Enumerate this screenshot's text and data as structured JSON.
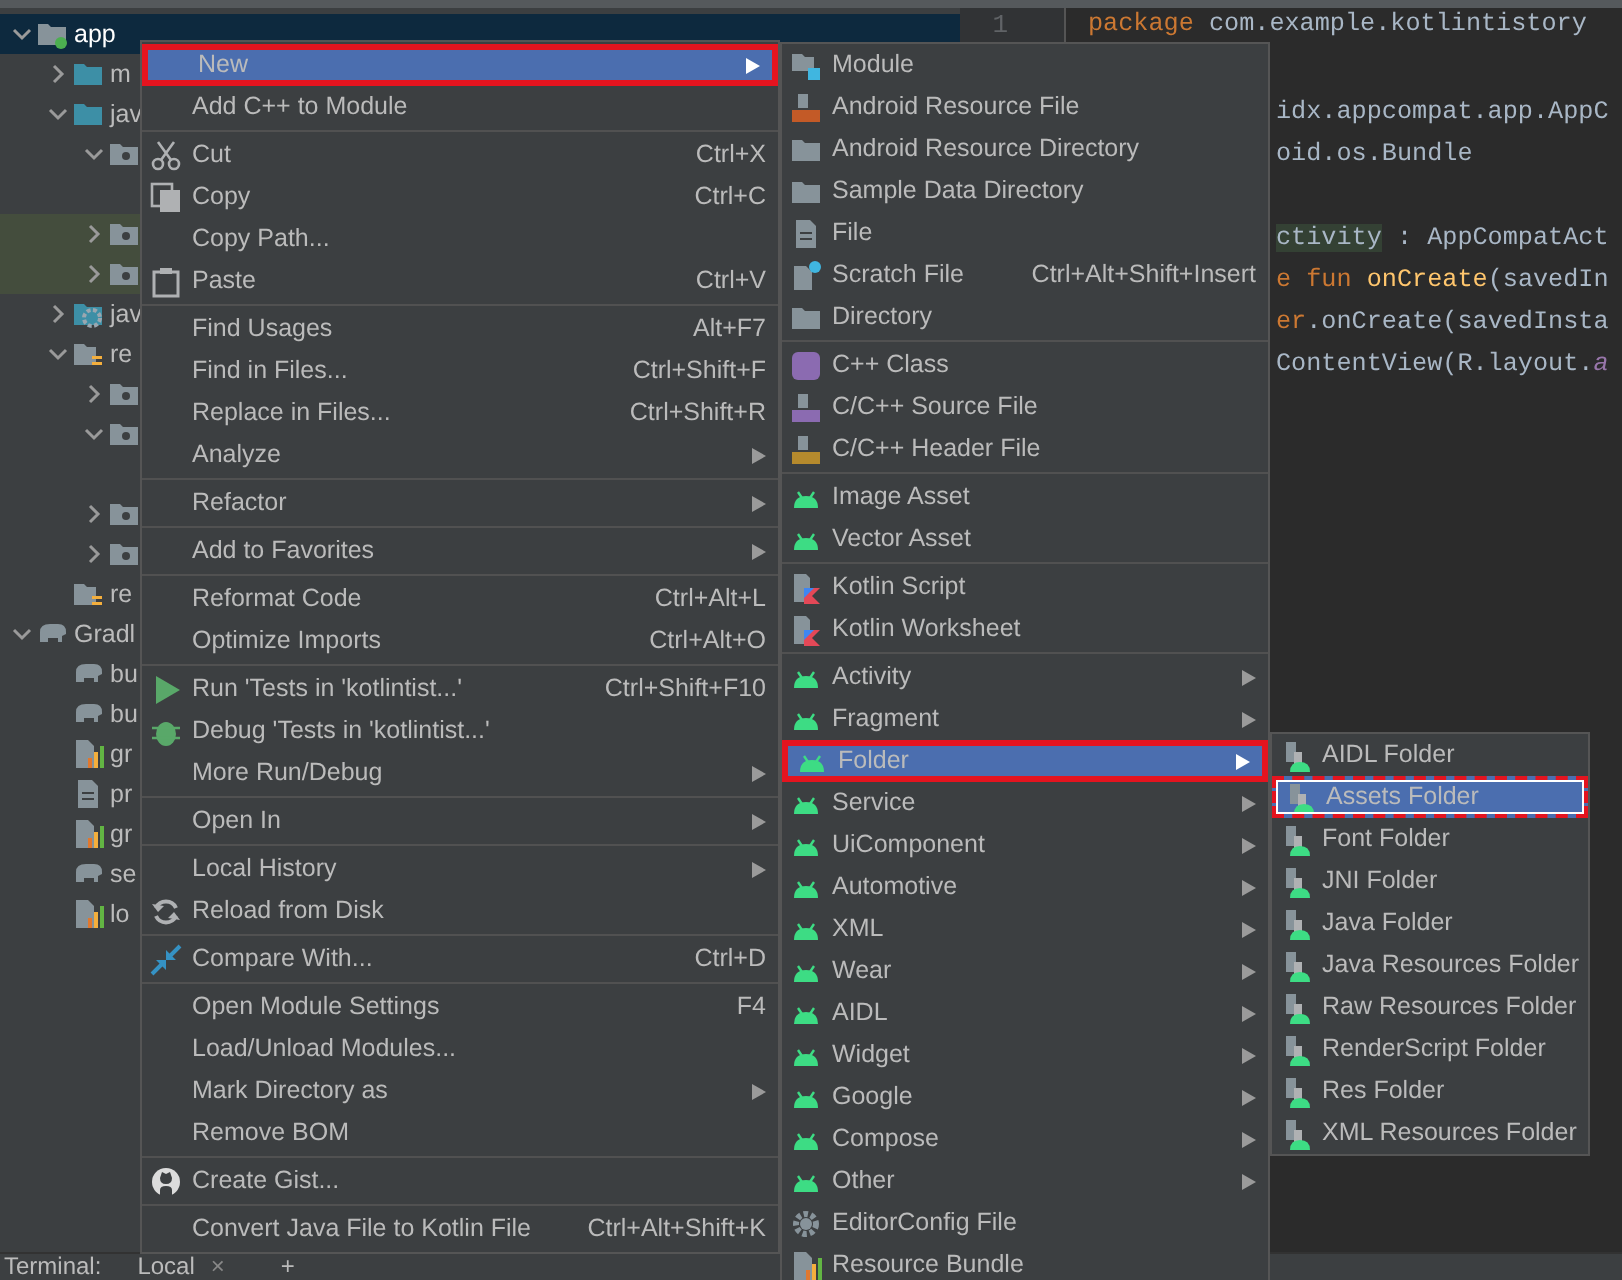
{
  "project_tree": [
    {
      "label": "app",
      "kind": "module",
      "expanded": true,
      "selected": true,
      "children": [
        {
          "label": "m",
          "kind": "source-folder",
          "expanded": false,
          "selected": false
        },
        {
          "label": "jav",
          "kind": "source-folder",
          "expanded": true,
          "selected": false,
          "children": [
            {
              "kind": "package",
              "expanded": true,
              "selected": false,
              "highlighted": false
            },
            {
              "kind": "package",
              "expanded": false,
              "selected": false,
              "highlighted": true
            },
            {
              "kind": "package",
              "expanded": false,
              "selected": false,
              "highlighted": true
            }
          ]
        },
        {
          "label": "jav",
          "kind": "generated-folder",
          "expanded": false,
          "selected": false
        },
        {
          "label": "re",
          "kind": "resource-folder",
          "expanded": true,
          "selected": false,
          "children": [
            {
              "kind": "package",
              "expanded": false,
              "selected": false
            },
            {
              "kind": "package",
              "expanded": true,
              "selected": false
            },
            {
              "kind": "package",
              "expanded": false,
              "selected": false
            },
            {
              "kind": "package",
              "expanded": false,
              "selected": false
            }
          ]
        },
        {
          "label": "re",
          "kind": "resource-folder",
          "selected": false
        }
      ]
    },
    {
      "label": "Gradl",
      "kind": "gradle",
      "expanded": true,
      "selected": false,
      "children": [
        {
          "label": "bu",
          "kind": "gradle",
          "selected": false
        },
        {
          "label": "bu",
          "kind": "gradle",
          "selected": false
        },
        {
          "label": "gr",
          "kind": "properties",
          "selected": false
        },
        {
          "label": "pr",
          "kind": "text",
          "selected": false
        },
        {
          "label": "gr",
          "kind": "properties",
          "selected": false
        },
        {
          "label": "se",
          "kind": "gradle",
          "selected": false
        },
        {
          "label": "lo",
          "kind": "properties",
          "selected": false
        }
      ]
    }
  ],
  "editor": {
    "line_numbers": [
      "1"
    ],
    "lines": [
      {
        "partial": false,
        "gap_before": false,
        "segments": [
          {
            "text": "package",
            "kind": "keyword"
          },
          {
            "text": " com.example.kotlintistory",
            "kind": "plain"
          }
        ]
      },
      {
        "partial": true,
        "gap_before": true,
        "segments": [
          {
            "text": "idx.appcompat.app.AppC",
            "kind": "plain"
          }
        ]
      },
      {
        "partial": true,
        "gap_before": false,
        "segments": [
          {
            "text": "oid.os.Bundle",
            "kind": "plain"
          }
        ]
      },
      {
        "partial": true,
        "gap_before": true,
        "segments": [
          {
            "text": "ctivity",
            "kind": "highlight"
          },
          {
            "text": " : AppCompatAct",
            "kind": "plain"
          }
        ]
      },
      {
        "partial": true,
        "gap_before": false,
        "segments": [
          {
            "text": "e fun",
            "kind": "keyword"
          },
          {
            "text": " onCreate",
            "kind": "function"
          },
          {
            "text": "(savedIn",
            "kind": "plain"
          }
        ]
      },
      {
        "partial": true,
        "gap_before": false,
        "segments": [
          {
            "text": "er",
            "kind": "keyword"
          },
          {
            "text": ".onCreate(savedInsta",
            "kind": "plain"
          }
        ]
      },
      {
        "partial": true,
        "gap_before": false,
        "segments": [
          {
            "text": "ContentView(R.layout.",
            "kind": "plain"
          },
          {
            "text": "a",
            "kind": "field"
          }
        ]
      }
    ]
  },
  "menus": [
    {
      "kind": "main",
      "groups": [
        [
          {
            "label": "New",
            "kind": "plain",
            "submenu": true,
            "selected": true
          },
          {
            "label": "Add C++ to Module",
            "kind": "plain",
            "selected": false
          }
        ],
        [
          {
            "label": "Cut",
            "shortcut": "Ctrl+X",
            "kind": "cut",
            "selected": false
          },
          {
            "label": "Copy",
            "shortcut": "Ctrl+C",
            "kind": "copy",
            "selected": false
          },
          {
            "label": "Copy Path...",
            "kind": "plain",
            "selected": false
          },
          {
            "label": "Paste",
            "shortcut": "Ctrl+V",
            "kind": "paste",
            "selected": false
          }
        ],
        [
          {
            "label": "Find Usages",
            "shortcut": "Alt+F7",
            "kind": "plain",
            "selected": false
          },
          {
            "label": "Find in Files...",
            "shortcut": "Ctrl+Shift+F",
            "kind": "plain",
            "selected": false
          },
          {
            "label": "Replace in Files...",
            "shortcut": "Ctrl+Shift+R",
            "kind": "plain",
            "selected": false
          },
          {
            "label": "Analyze",
            "kind": "plain",
            "submenu": true,
            "selected": false
          }
        ],
        [
          {
            "label": "Refactor",
            "kind": "plain",
            "submenu": true,
            "selected": false
          }
        ],
        [
          {
            "label": "Add to Favorites",
            "kind": "plain",
            "submenu": true,
            "selected": false
          }
        ],
        [
          {
            "label": "Reformat Code",
            "shortcut": "Ctrl+Alt+L",
            "kind": "plain",
            "selected": false
          },
          {
            "label": "Optimize Imports",
            "shortcut": "Ctrl+Alt+O",
            "kind": "plain",
            "selected": false
          }
        ],
        [
          {
            "label": "Run 'Tests in 'kotlintist...'",
            "shortcut": "Ctrl+Shift+F10",
            "kind": "run",
            "selected": false
          },
          {
            "label": "Debug 'Tests in 'kotlintist...'",
            "kind": "debug",
            "selected": false
          },
          {
            "label": "More Run/Debug",
            "kind": "plain",
            "submenu": true,
            "selected": false
          }
        ],
        [
          {
            "label": "Open In",
            "kind": "plain",
            "submenu": true,
            "selected": false
          }
        ],
        [
          {
            "label": "Local History",
            "kind": "plain",
            "submenu": true,
            "selected": false
          },
          {
            "label": "Reload from Disk",
            "kind": "reload",
            "selected": false
          }
        ],
        [
          {
            "label": "Compare With...",
            "shortcut": "Ctrl+D",
            "kind": "compare",
            "selected": false
          }
        ],
        [
          {
            "label": "Open Module Settings",
            "shortcut": "F4",
            "kind": "plain",
            "selected": false
          },
          {
            "label": "Load/Unload Modules...",
            "kind": "plain",
            "selected": false
          },
          {
            "label": "Mark Directory as",
            "kind": "plain",
            "submenu": true,
            "selected": false
          },
          {
            "label": "Remove BOM",
            "kind": "plain",
            "selected": false
          }
        ],
        [
          {
            "label": "Create Gist...",
            "kind": "gist",
            "selected": false
          }
        ],
        [
          {
            "label": "Convert Java File to Kotlin File",
            "shortcut": "Ctrl+Alt+Shift+K",
            "kind": "plain",
            "selected": false
          }
        ]
      ]
    },
    {
      "kind": "sub",
      "groups": [
        [
          {
            "label": "Module",
            "kind": "module",
            "selected": false
          },
          {
            "label": "Android Resource File",
            "kind": "resource-file",
            "selected": false
          },
          {
            "label": "Android Resource Directory",
            "kind": "directory",
            "selected": false
          },
          {
            "label": "Sample Data Directory",
            "kind": "directory",
            "selected": false
          },
          {
            "label": "File",
            "kind": "file",
            "selected": false
          },
          {
            "label": "Scratch File",
            "shortcut": "Ctrl+Alt+Shift+Insert",
            "kind": "scratch",
            "selected": false
          },
          {
            "label": "Directory",
            "kind": "directory",
            "selected": false
          }
        ],
        [
          {
            "label": "C++ Class",
            "kind": "class",
            "selected": false
          },
          {
            "label": "C/C++ Source File",
            "kind": "source",
            "selected": false
          },
          {
            "label": "C/C++ Header File",
            "kind": "header",
            "selected": false
          }
        ],
        [
          {
            "label": "Image Asset",
            "kind": "android",
            "selected": false
          },
          {
            "label": "Vector Asset",
            "kind": "android",
            "selected": false
          }
        ],
        [
          {
            "label": "Kotlin Script",
            "kind": "kotlin",
            "selected": false
          },
          {
            "label": "Kotlin Worksheet",
            "kind": "kotlin",
            "selected": false
          }
        ],
        [
          {
            "label": "Activity",
            "kind": "android",
            "submenu": true,
            "selected": false
          },
          {
            "label": "Fragment",
            "kind": "android",
            "submenu": true,
            "selected": false
          },
          {
            "label": "Folder",
            "kind": "android",
            "submenu": true,
            "selected": true
          },
          {
            "label": "Service",
            "kind": "android",
            "submenu": true,
            "selected": false
          },
          {
            "label": "UiComponent",
            "kind": "android",
            "submenu": true,
            "selected": false
          },
          {
            "label": "Automotive",
            "kind": "android",
            "submenu": true,
            "selected": false
          },
          {
            "label": "XML",
            "kind": "android",
            "submenu": true,
            "selected": false
          },
          {
            "label": "Wear",
            "kind": "android",
            "submenu": true,
            "selected": false
          },
          {
            "label": "AIDL",
            "kind": "android",
            "submenu": true,
            "selected": false
          },
          {
            "label": "Widget",
            "kind": "android",
            "submenu": true,
            "selected": false
          },
          {
            "label": "Google",
            "kind": "android",
            "submenu": true,
            "selected": false
          },
          {
            "label": "Compose",
            "kind": "android",
            "submenu": true,
            "selected": false
          },
          {
            "label": "Other",
            "kind": "android",
            "submenu": true,
            "selected": false
          },
          {
            "label": "EditorConfig File",
            "kind": "config",
            "selected": false
          },
          {
            "label": "Resource Bundle",
            "kind": "bundle",
            "selected": false
          }
        ]
      ]
    },
    {
      "kind": "folder",
      "groups": [
        [
          {
            "label": "AIDL Folder",
            "kind": "android-folder",
            "selected": false
          },
          {
            "label": "Assets Folder",
            "kind": "android-folder",
            "selected": true
          },
          {
            "label": "Font Folder",
            "kind": "android-folder",
            "selected": false
          },
          {
            "label": "JNI Folder",
            "kind": "android-folder",
            "selected": false
          },
          {
            "label": "Java Folder",
            "kind": "android-folder",
            "selected": false
          },
          {
            "label": "Java Resources Folder",
            "kind": "android-folder",
            "selected": false
          },
          {
            "label": "Raw Resources Folder",
            "kind": "android-folder",
            "selected": false
          },
          {
            "label": "RenderScript Folder",
            "kind": "android-folder",
            "selected": false
          },
          {
            "label": "Res Folder",
            "kind": "android-folder",
            "selected": false
          },
          {
            "label": "XML Resources Folder",
            "kind": "android-folder",
            "selected": false
          }
        ]
      ]
    }
  ],
  "tool_bar": {
    "title": "Terminal:",
    "tabs": [
      {
        "label": "Local",
        "close": "×"
      }
    ],
    "add": "+"
  }
}
